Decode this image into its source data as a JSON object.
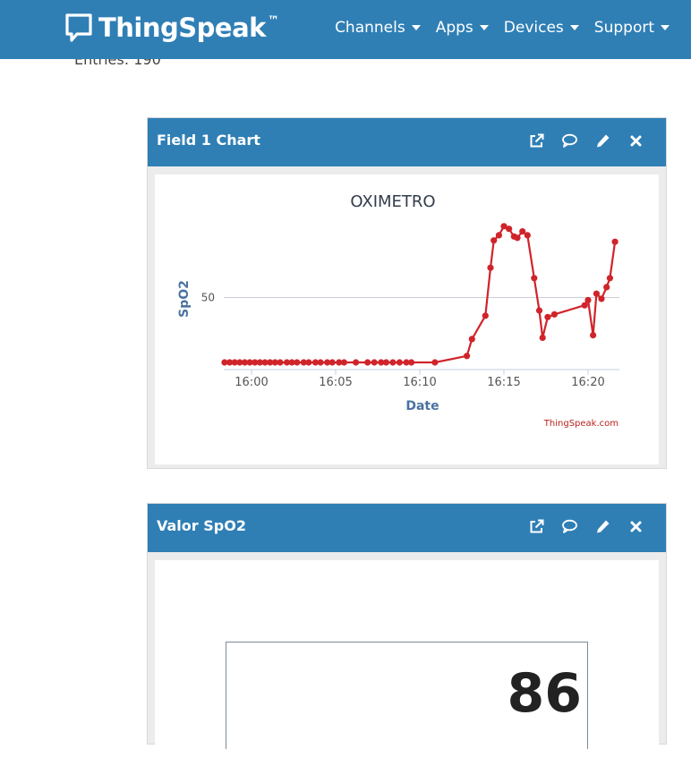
{
  "navbar": {
    "brand": "ThingSpeak",
    "brand_tm": "™",
    "items": [
      "Channels",
      "Apps",
      "Devices",
      "Support"
    ]
  },
  "entries_text": "Entries: 190",
  "panel1": {
    "title": "Field 1 Chart"
  },
  "panel2": {
    "title": "Valor SpO2",
    "value": "86"
  },
  "icons": [
    "external-link-icon",
    "comment-icon",
    "pencil-icon",
    "close-icon"
  ],
  "colors": {
    "header": "#2f7fb5",
    "series": "#d0242b",
    "axis_label": "#4a72a0"
  },
  "chart_data": {
    "type": "line",
    "title": "OXIMETRO",
    "xlabel": "Date",
    "ylabel": "SpO2",
    "xticks": [
      "16:00",
      "16:05",
      "16:10",
      "16:15",
      "16:20"
    ],
    "yticks": [
      50
    ],
    "grid": true,
    "credit": "ThingSpeak.com",
    "series": [
      {
        "values": [
          [
            "15:58.4",
            0
          ],
          [
            "15:58.7",
            0
          ],
          [
            "15:59.0",
            0
          ],
          [
            "15:59.3",
            0
          ],
          [
            "15:59.6",
            0
          ],
          [
            "15:59.9",
            0
          ],
          [
            "16:00.2",
            0
          ],
          [
            "16:00.5",
            0
          ],
          [
            "16:00.8",
            0
          ],
          [
            "16:01.1",
            0
          ],
          [
            "16:01.4",
            0
          ],
          [
            "16:01.7",
            0
          ],
          [
            "16:02.1",
            0
          ],
          [
            "16:02.4",
            0
          ],
          [
            "16:02.7",
            0
          ],
          [
            "16:03.1",
            0
          ],
          [
            "16:03.4",
            0
          ],
          [
            "16:03.8",
            0
          ],
          [
            "16:04.1",
            0
          ],
          [
            "16:04.5",
            0
          ],
          [
            "16:04.8",
            0
          ],
          [
            "16:05.2",
            0
          ],
          [
            "16:05.5",
            0
          ],
          [
            "16:06.2",
            0
          ],
          [
            "16:06.9",
            0
          ],
          [
            "16:07.3",
            0
          ],
          [
            "16:07.7",
            0
          ],
          [
            "16:08.0",
            0
          ],
          [
            "16:08.4",
            0
          ],
          [
            "16:08.8",
            0
          ],
          [
            "16:09.2",
            0
          ],
          [
            "16:09.5",
            0
          ],
          [
            "16:10.9",
            0
          ],
          [
            "16:12.8",
            5
          ],
          [
            "16:13.1",
            18
          ],
          [
            "16:13.9",
            36
          ],
          [
            "16:14.2",
            73
          ],
          [
            "16:14.4",
            94
          ],
          [
            "16:14.7",
            98
          ],
          [
            "16:15.0",
            105
          ],
          [
            "16:15.3",
            103
          ],
          [
            "16:15.6",
            97
          ],
          [
            "16:15.8",
            96
          ],
          [
            "16:16.1",
            101
          ],
          [
            "16:16.4",
            98
          ],
          [
            "16:16.8",
            65
          ],
          [
            "16:17.1",
            40
          ],
          [
            "16:17.3",
            19
          ],
          [
            "16:17.6",
            35
          ],
          [
            "16:18.0",
            37
          ],
          [
            "16:19.8",
            44
          ],
          [
            "16:20.0",
            48
          ],
          [
            "16:20.3",
            21
          ],
          [
            "16:20.5",
            53
          ],
          [
            "16:20.8",
            49
          ],
          [
            "16:21.1",
            58
          ],
          [
            "16:21.3",
            65
          ],
          [
            "16:21.6",
            93
          ]
        ]
      }
    ]
  }
}
